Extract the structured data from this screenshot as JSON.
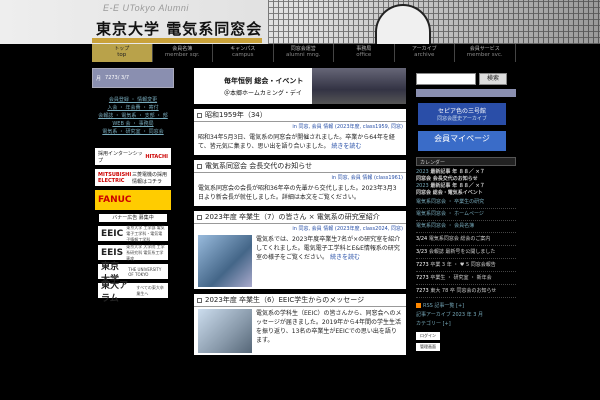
{
  "header": {
    "subtitle": "E-E UTokyo Alumni",
    "title": "東京大学 電気系同窓会"
  },
  "nav": [
    {
      "jp": "トップ",
      "en": "top"
    },
    {
      "jp": "会員名簿",
      "en": "member sqr."
    },
    {
      "jp": "キャンパス",
      "en": "campus"
    },
    {
      "jp": "同窓会運営",
      "en": "alumni mng."
    },
    {
      "jp": "事務局",
      "en": "office"
    },
    {
      "jp": "アーカイブ",
      "en": "archive"
    },
    {
      "jp": "会員サービス",
      "en": "member svc."
    }
  ],
  "left": {
    "bar_items": [
      "月",
      "7273/ 3/7"
    ],
    "links": [
      "会員登録 ・ 情報変更",
      "入会 ・ 年会費 ・ 寄付",
      "会報誌 ・ 電気系 ・ 支部 ・ 部",
      "WEB 会 ・ 事務局",
      "電気系 ・ 研究室 ・ 同窓会"
    ],
    "banners": [
      {
        "left": "採用インターンシップ",
        "right": "HITACHI"
      },
      {
        "left": "MITSUBISHI ELECTRIC",
        "right": "三菱電機の採用情報はコチラ"
      }
    ],
    "fanuc": "FANUC",
    "banner_label": "バナー広告 募集中",
    "logos": [
      {
        "name": "EEIC",
        "sub": "東京大学 工学部 電気電子工学科・電気電子情報工学科"
      },
      {
        "name": "EEIS",
        "sub": "東京大学 大学院 工学系研究科 電気系工学専攻"
      },
      {
        "name": "東京大学",
        "sub": "THE UNIVERSITY OF TOKYO"
      },
      {
        "name": "東大アラム",
        "sub": "すべての東大卒業生へ"
      }
    ]
  },
  "center": {
    "event": {
      "line1": "毎年恒例 総会・イベント",
      "line2": "＠本郷ホームカミング・デイ"
    },
    "posts": [
      {
        "title": "昭和1959年（34）",
        "meta": "in 同窓, 会員 情報 (2023年度, class1959, 同窓)",
        "body": "昭和34年5月3日、電気系の同窓会が開催されました。卒業から64年を経て、皆元気に集まり、思い出を語り合いました。",
        "more": "続きを読む"
      },
      {
        "title": "電気系同窓会 会長交代のお知らせ",
        "meta": "in 同窓, 会員 情報 (class1961)",
        "body": "電気系同窓会の会長が昭和36年卒の先輩から交代しました。2023年3月3日より新会長が就任しました。詳細は本文をご覧ください。",
        "more": ""
      },
      {
        "title": "2023年度 卒業生（7）の皆さん × 電気系の研究室紹介",
        "meta": "in 同窓, 会員 情報 (2023年度, class2024, 同窓)",
        "body": "電気系では、2023年度卒業生7名が×の研究室を紹介してくれました。電気電子工学科とE&E情報系の研究室の様子をご覧ください。",
        "more": "続きを読む"
      },
      {
        "title": "2023年度 卒業生（6）EEIC学生からのメッセージ",
        "meta": "in 同窓, 会員 情報 (2023年度, class2024, 同窓)",
        "body": "電気系の学科生（EEIC）の皆さんから、同窓会へのメッセージが届きました。2019年から4年間の学生生活を振り返り、13名の卒業生がEEICでの思い出を語ります。",
        "more": ""
      }
    ]
  },
  "right": {
    "search_button": "検索",
    "banner1": {
      "main": "セピア色の三号館",
      "sub": "同窓会歴史アーカイブ"
    },
    "banner2": "会員マイページ",
    "calendar_head": "カレンダー",
    "calendar": [
      {
        "date": "2023",
        "text": "最新記事 年 ８８／ ×７"
      },
      {
        "date": "",
        "text": "同窓会 会長交代のお知らせ"
      },
      {
        "date": "2023",
        "text": "最新記事 年 ８８／ ×７"
      },
      {
        "date": "",
        "text": "同窓会 総会・電気系イベント"
      }
    ],
    "links": [
      "電気系同窓会 ・ 卒業生の研究",
      "電気系同窓会 ・ ホームページ",
      "電気系同窓会 ・ 会員名簿"
    ],
    "news": [
      {
        "date": "3/24",
        "text": "電気系同窓会 総会のご案内"
      },
      {
        "date": "3/23",
        "text": "会報誌 最新号を公開しました"
      },
      {
        "date": "7273",
        "text": "卒業 3 年 ・ ♥ 5 同窓会報告"
      },
      {
        "date": "7273",
        "text": "卒業生 ・ 研究室 ・ 新年会"
      },
      {
        "date": "7273",
        "text": "東大 78 卒 同窓会のお知らせ"
      }
    ],
    "rss": [
      "RSS 記事一覧 [+]",
      "記事アーカイブ 2023 年 3 月",
      "カテゴリー [+]"
    ],
    "widgets": [
      "ログイン",
      "管理画面"
    ]
  }
}
